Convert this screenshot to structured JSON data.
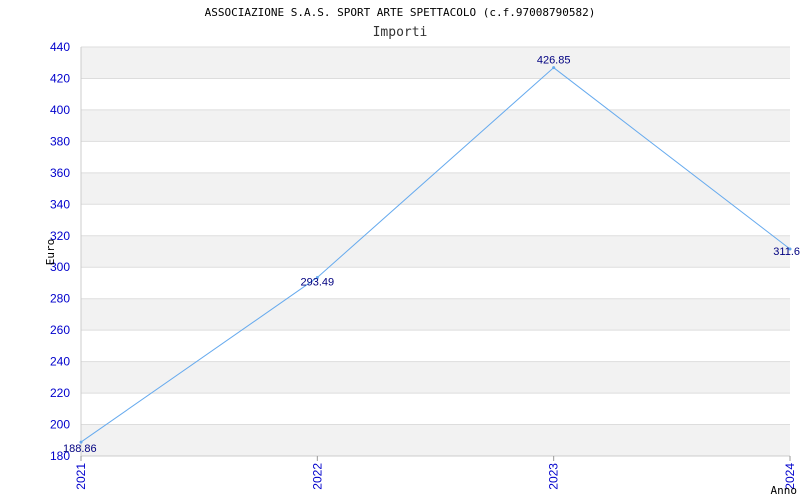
{
  "chart_data": {
    "type": "line",
    "title": "ASSOCIAZIONE S.A.S. SPORT ARTE SPETTACOLO (c.f.97008790582)",
    "subtitle": "Importi",
    "xlabel": "Anno",
    "ylabel": "Euro",
    "categories": [
      "2021",
      "2022",
      "2023",
      "2024"
    ],
    "series": [
      {
        "values": [
          188.86,
          293.49,
          426.85,
          311.6
        ],
        "labels": [
          "188.86",
          "293.49",
          "426.85",
          "311.6"
        ]
      }
    ],
    "ylim": [
      180,
      440
    ],
    "yticks": [
      180,
      200,
      220,
      240,
      260,
      280,
      300,
      320,
      340,
      360,
      380,
      400,
      420,
      440
    ],
    "grid": true,
    "legend": "none",
    "colors": {
      "line": "#66aaee",
      "band": "#f2f2f2",
      "grid": "#dddddd",
      "tick_text": "#0000cc",
      "label_text": "#000080"
    }
  }
}
